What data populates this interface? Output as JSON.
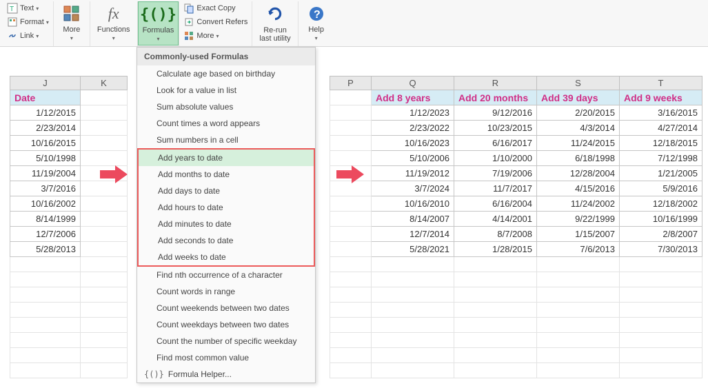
{
  "ribbon": {
    "text_menu": "Text",
    "format_menu": "Format",
    "link_menu": "Link",
    "more1": "More",
    "functions": "Functions",
    "formulas": "Formulas",
    "exact_copy": "Exact Copy",
    "convert_refers": "Convert Refers",
    "more2": "More",
    "rerun": "Re-run\nlast utility",
    "help": "Help"
  },
  "dropdown": {
    "header": "Commonly-used Formulas",
    "items": [
      "Calculate age based on birthday",
      "Look for a value in list",
      "Sum absolute values",
      "Count times a word appears",
      "Sum numbers in a cell",
      "Add years to date",
      "Add months to date",
      "Add days to date",
      "Add hours to date",
      "Add minutes to date",
      "Add seconds to date",
      "Add weeks to date",
      "Find nth occurrence of a character",
      "Count words in range",
      "Count weekends between two dates",
      "Count weekdays between two dates",
      "Count the number of specific weekday",
      "Find most common value"
    ],
    "helper": "Formula Helper..."
  },
  "columns": {
    "left": [
      "J",
      "K"
    ],
    "right": [
      "P",
      "Q",
      "R",
      "S",
      "T"
    ]
  },
  "left_table": {
    "header": "Date",
    "rows": [
      "1/12/2015",
      "2/23/2014",
      "10/16/2015",
      "5/10/1998",
      "11/19/2004",
      "3/7/2016",
      "10/16/2002",
      "8/14/1999",
      "12/7/2006",
      "5/28/2013"
    ]
  },
  "right_table": {
    "headers": [
      "Add 8 years",
      "Add 20 months",
      "Add 39 days",
      "Add 9 weeks"
    ],
    "rows": [
      [
        "1/12/2023",
        "9/12/2016",
        "2/20/2015",
        "3/16/2015"
      ],
      [
        "2/23/2022",
        "10/23/2015",
        "4/3/2014",
        "4/27/2014"
      ],
      [
        "10/16/2023",
        "6/16/2017",
        "11/24/2015",
        "12/18/2015"
      ],
      [
        "5/10/2006",
        "1/10/2000",
        "6/18/1998",
        "7/12/1998"
      ],
      [
        "11/19/2012",
        "7/19/2006",
        "12/28/2004",
        "1/21/2005"
      ],
      [
        "3/7/2024",
        "11/7/2017",
        "4/15/2016",
        "5/9/2016"
      ],
      [
        "10/16/2010",
        "6/16/2004",
        "11/24/2002",
        "12/18/2002"
      ],
      [
        "8/14/2007",
        "4/14/2001",
        "9/22/1999",
        "10/16/1999"
      ],
      [
        "12/7/2014",
        "8/7/2008",
        "1/15/2007",
        "2/8/2007"
      ],
      [
        "5/28/2021",
        "1/28/2015",
        "7/6/2013",
        "7/30/2013"
      ]
    ]
  }
}
